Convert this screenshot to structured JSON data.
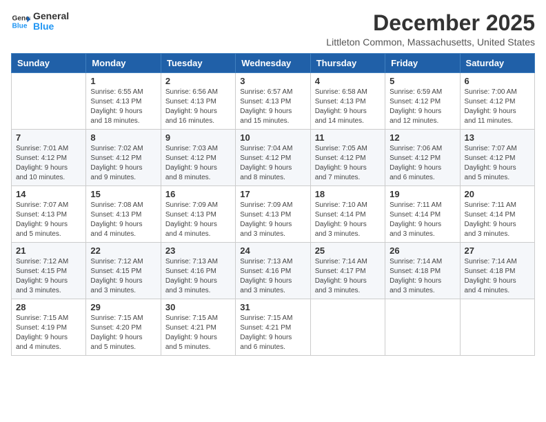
{
  "logo": {
    "text_general": "General",
    "text_blue": "Blue"
  },
  "title": {
    "month_year": "December 2025",
    "location": "Littleton Common, Massachusetts, United States"
  },
  "days_header": [
    "Sunday",
    "Monday",
    "Tuesday",
    "Wednesday",
    "Thursday",
    "Friday",
    "Saturday"
  ],
  "weeks": [
    [
      {
        "day": "",
        "info": ""
      },
      {
        "day": "1",
        "info": "Sunrise: 6:55 AM\nSunset: 4:13 PM\nDaylight: 9 hours\nand 18 minutes."
      },
      {
        "day": "2",
        "info": "Sunrise: 6:56 AM\nSunset: 4:13 PM\nDaylight: 9 hours\nand 16 minutes."
      },
      {
        "day": "3",
        "info": "Sunrise: 6:57 AM\nSunset: 4:13 PM\nDaylight: 9 hours\nand 15 minutes."
      },
      {
        "day": "4",
        "info": "Sunrise: 6:58 AM\nSunset: 4:13 PM\nDaylight: 9 hours\nand 14 minutes."
      },
      {
        "day": "5",
        "info": "Sunrise: 6:59 AM\nSunset: 4:12 PM\nDaylight: 9 hours\nand 12 minutes."
      },
      {
        "day": "6",
        "info": "Sunrise: 7:00 AM\nSunset: 4:12 PM\nDaylight: 9 hours\nand 11 minutes."
      }
    ],
    [
      {
        "day": "7",
        "info": "Sunrise: 7:01 AM\nSunset: 4:12 PM\nDaylight: 9 hours\nand 10 minutes."
      },
      {
        "day": "8",
        "info": "Sunrise: 7:02 AM\nSunset: 4:12 PM\nDaylight: 9 hours\nand 9 minutes."
      },
      {
        "day": "9",
        "info": "Sunrise: 7:03 AM\nSunset: 4:12 PM\nDaylight: 9 hours\nand 8 minutes."
      },
      {
        "day": "10",
        "info": "Sunrise: 7:04 AM\nSunset: 4:12 PM\nDaylight: 9 hours\nand 8 minutes."
      },
      {
        "day": "11",
        "info": "Sunrise: 7:05 AM\nSunset: 4:12 PM\nDaylight: 9 hours\nand 7 minutes."
      },
      {
        "day": "12",
        "info": "Sunrise: 7:06 AM\nSunset: 4:12 PM\nDaylight: 9 hours\nand 6 minutes."
      },
      {
        "day": "13",
        "info": "Sunrise: 7:07 AM\nSunset: 4:12 PM\nDaylight: 9 hours\nand 5 minutes."
      }
    ],
    [
      {
        "day": "14",
        "info": "Sunrise: 7:07 AM\nSunset: 4:13 PM\nDaylight: 9 hours\nand 5 minutes."
      },
      {
        "day": "15",
        "info": "Sunrise: 7:08 AM\nSunset: 4:13 PM\nDaylight: 9 hours\nand 4 minutes."
      },
      {
        "day": "16",
        "info": "Sunrise: 7:09 AM\nSunset: 4:13 PM\nDaylight: 9 hours\nand 4 minutes."
      },
      {
        "day": "17",
        "info": "Sunrise: 7:09 AM\nSunset: 4:13 PM\nDaylight: 9 hours\nand 3 minutes."
      },
      {
        "day": "18",
        "info": "Sunrise: 7:10 AM\nSunset: 4:14 PM\nDaylight: 9 hours\nand 3 minutes."
      },
      {
        "day": "19",
        "info": "Sunrise: 7:11 AM\nSunset: 4:14 PM\nDaylight: 9 hours\nand 3 minutes."
      },
      {
        "day": "20",
        "info": "Sunrise: 7:11 AM\nSunset: 4:14 PM\nDaylight: 9 hours\nand 3 minutes."
      }
    ],
    [
      {
        "day": "21",
        "info": "Sunrise: 7:12 AM\nSunset: 4:15 PM\nDaylight: 9 hours\nand 3 minutes."
      },
      {
        "day": "22",
        "info": "Sunrise: 7:12 AM\nSunset: 4:15 PM\nDaylight: 9 hours\nand 3 minutes."
      },
      {
        "day": "23",
        "info": "Sunrise: 7:13 AM\nSunset: 4:16 PM\nDaylight: 9 hours\nand 3 minutes."
      },
      {
        "day": "24",
        "info": "Sunrise: 7:13 AM\nSunset: 4:16 PM\nDaylight: 9 hours\nand 3 minutes."
      },
      {
        "day": "25",
        "info": "Sunrise: 7:14 AM\nSunset: 4:17 PM\nDaylight: 9 hours\nand 3 minutes."
      },
      {
        "day": "26",
        "info": "Sunrise: 7:14 AM\nSunset: 4:18 PM\nDaylight: 9 hours\nand 3 minutes."
      },
      {
        "day": "27",
        "info": "Sunrise: 7:14 AM\nSunset: 4:18 PM\nDaylight: 9 hours\nand 4 minutes."
      }
    ],
    [
      {
        "day": "28",
        "info": "Sunrise: 7:15 AM\nSunset: 4:19 PM\nDaylight: 9 hours\nand 4 minutes."
      },
      {
        "day": "29",
        "info": "Sunrise: 7:15 AM\nSunset: 4:20 PM\nDaylight: 9 hours\nand 5 minutes."
      },
      {
        "day": "30",
        "info": "Sunrise: 7:15 AM\nSunset: 4:21 PM\nDaylight: 9 hours\nand 5 minutes."
      },
      {
        "day": "31",
        "info": "Sunrise: 7:15 AM\nSunset: 4:21 PM\nDaylight: 9 hours\nand 6 minutes."
      },
      {
        "day": "",
        "info": ""
      },
      {
        "day": "",
        "info": ""
      },
      {
        "day": "",
        "info": ""
      }
    ]
  ]
}
